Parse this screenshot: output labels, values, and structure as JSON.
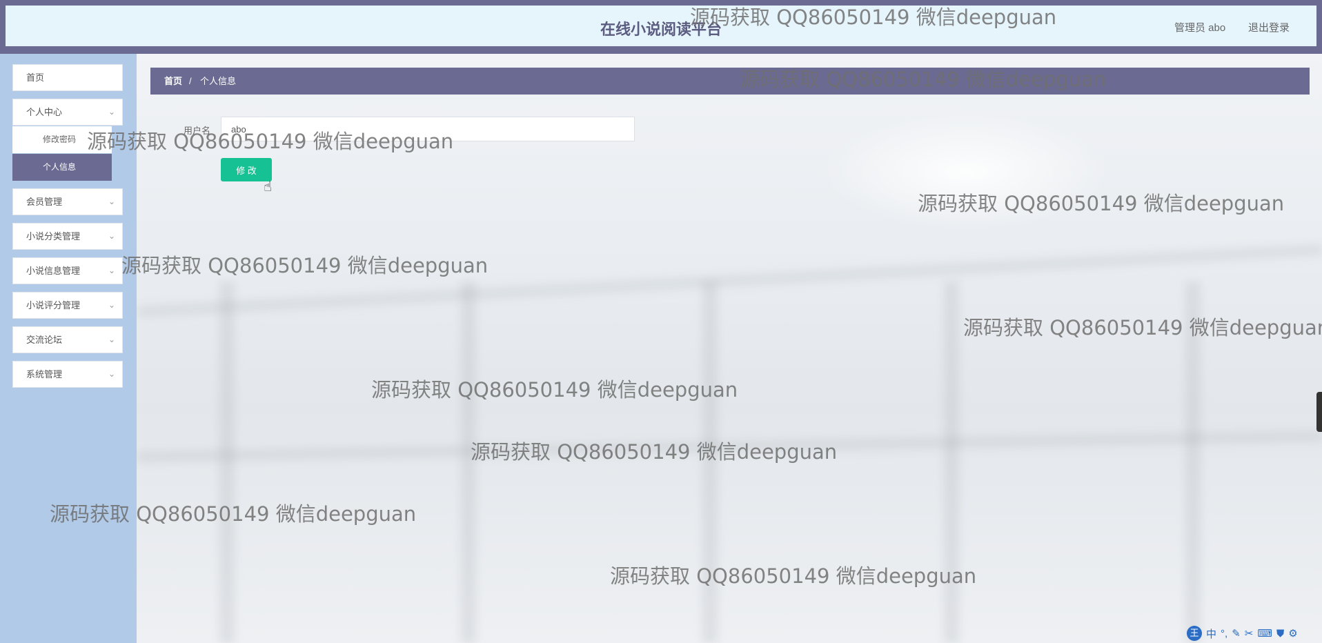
{
  "header": {
    "title": "在线小说阅读平台",
    "admin": "管理员 abo",
    "logout": "退出登录"
  },
  "sidebar": {
    "items": [
      {
        "label": "首页"
      },
      {
        "label": "个人中心"
      },
      {
        "label": "会员管理"
      },
      {
        "label": "小说分类管理"
      },
      {
        "label": "小说信息管理"
      },
      {
        "label": "小说评分管理"
      },
      {
        "label": "交流论坛"
      },
      {
        "label": "系统管理"
      }
    ],
    "submenu": [
      {
        "label": "修改密码"
      },
      {
        "label": "个人信息",
        "active": true
      }
    ]
  },
  "breadcrumb": {
    "home": "首页",
    "separator": "/",
    "current": "个人信息"
  },
  "form": {
    "username_label": "用户名",
    "username_value": "abo",
    "submit_label": "修 改"
  },
  "watermark": "源码获取 QQ86050149 微信deepguan",
  "tray": {
    "ime": "王",
    "lang": "中"
  },
  "colors": {
    "header_bar": "#6a6a92",
    "header_bg": "#e6f4fc",
    "sidebar_bg": "#b0cae8",
    "active_bg": "#6a6a92",
    "button_green": "#16c293"
  }
}
